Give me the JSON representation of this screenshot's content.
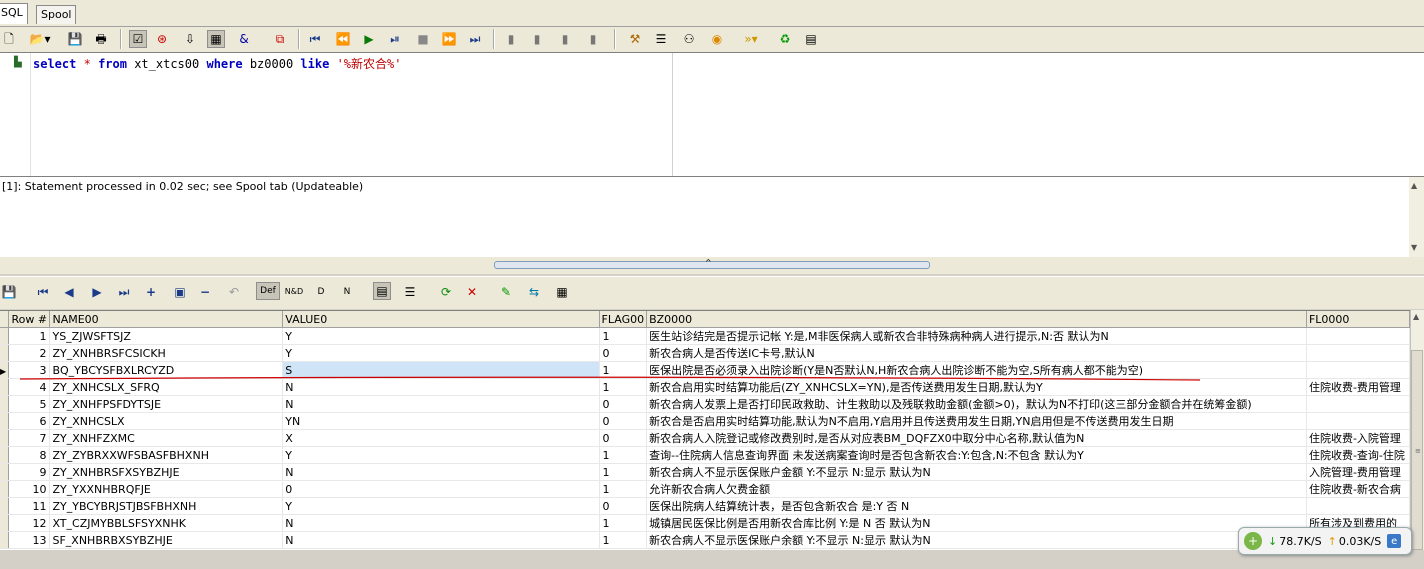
{
  "tabs": [
    {
      "label": "SQL",
      "active": true
    },
    {
      "label": "Spool",
      "active": false
    }
  ],
  "toolbar": {
    "icons": [
      "new-icon",
      "open-icon",
      "save-icon",
      "print-icon",
      "options-icon",
      "explain-icon",
      "commit-icon",
      "query-builder-icon",
      "find-icon",
      "window-icon",
      "first-icon",
      "prev-icon",
      "run-icon",
      "run-step-icon",
      "stop-icon",
      "next-icon",
      "last-icon",
      "doc1-icon",
      "doc2-icon",
      "doc3-icon",
      "doc4-icon",
      "tools-icon",
      "list-icon",
      "binoculars-icon",
      "spinner-icon",
      "bookmark-icon",
      "recycle-icon",
      "grid-icon"
    ]
  },
  "editor": {
    "kw_select": "select",
    "star": "*",
    "kw_from": "from",
    "table": "xt_xtcs00",
    "kw_where": "where",
    "column": "bz0000",
    "kw_like": "like",
    "pattern": "'%新农合%'"
  },
  "message": "[1]: Statement processed in 0.02 sec; see Spool tab (Updateable)",
  "grid": {
    "columns": [
      "Row #",
      "NAME00",
      "VALUE0",
      "FLAG00",
      "BZ0000",
      "FL0000"
    ],
    "rows": [
      {
        "n": "1",
        "name": "YS_ZJWSFTSJZ",
        "value": "Y",
        "flag": "1",
        "bz": "医生站诊结完是否提示记帐 Y:是,M非医保病人或新农合非特殊病种病人进行提示,N:否 默认为N",
        "fl": ""
      },
      {
        "n": "2",
        "name": "ZY_XNHBRSFCSICKH",
        "value": "Y",
        "flag": "0",
        "bz": "新农合病人是否传送IC卡号,默认N",
        "fl": ""
      },
      {
        "n": "3",
        "name": "BQ_YBCYSFBXLRCYZD",
        "value": "S",
        "flag": "1",
        "bz": "医保出院是否必须录入出院诊断(Y是N否默认N,H新农合病人出院诊断不能为空,S所有病人都不能为空)",
        "fl": ""
      },
      {
        "n": "4",
        "name": "ZY_XNHCSLX_SFRQ",
        "value": "N",
        "flag": "1",
        "bz": "新农合启用实时结算功能后(ZY_XNHCSLX=YN),是否传送费用发生日期,默认为Y",
        "fl": "住院收费-费用管理"
      },
      {
        "n": "5",
        "name": "ZY_XNHFPSFDYTSJE",
        "value": "N",
        "flag": "0",
        "bz": "新农合病人发票上是否打印民政救助、计生救助以及残联救助金额(金额>0)，默认为N不打印(这三部分金额合并在统筹金额)",
        "fl": ""
      },
      {
        "n": "6",
        "name": "ZY_XNHCSLX",
        "value": "YN",
        "flag": "0",
        "bz": "新农合是否启用实时结算功能,默认为N不启用,Y启用并且传送费用发生日期,YN启用但是不传送费用发生日期",
        "fl": ""
      },
      {
        "n": "7",
        "name": "ZY_XNHFZXMC",
        "value": "X",
        "flag": "0",
        "bz": "新农合病人入院登记或修改费别时,是否从对应表BM_DQFZX0中取分中心名称,默认值为N",
        "fl": "住院收费-入院管理"
      },
      {
        "n": "8",
        "name": "ZY_ZYBRXXWFSBASFBHXNH",
        "value": "Y",
        "flag": "1",
        "bz": "查询--住院病人信息查询界面 未发送病案查询时是否包含新农合:Y:包含,N:不包含 默认为Y",
        "fl": "住院收费-查询-住院"
      },
      {
        "n": "9",
        "name": "ZY_XNHBRSFXSYBZHJE",
        "value": "N",
        "flag": "1",
        "bz": "新农合病人不显示医保账户金额 Y:不显示 N:显示 默认为N",
        "fl": "入院管理-费用管理"
      },
      {
        "n": "10",
        "name": "ZY_YXXNHBRQFJE",
        "value": "0",
        "flag": "1",
        "bz": "允许新农合病人欠费金额",
        "fl": "住院收费-新农合病"
      },
      {
        "n": "11",
        "name": "ZY_YBCYBRJSTJBSFBHXNH",
        "value": "Y",
        "flag": "0",
        "bz": "医保出院病人结算统计表，是否包含新农合 是:Y 否 N",
        "fl": ""
      },
      {
        "n": "12",
        "name": "XT_CZJMYBBLSFSYXNHK",
        "value": "N",
        "flag": "1",
        "bz": "城镇居民医保比例是否用新农合库比例 Y:是 N 否 默认为N",
        "fl": "所有涉及到费用的"
      },
      {
        "n": "13",
        "name": "SF_XNHBRBXSYBZHJE",
        "value": "N",
        "flag": "1",
        "bz": "新农合病人不显示医保账户余额 Y:不显示 N:显示 默认为N",
        "fl": ""
      }
    ]
  },
  "net": {
    "down": "78.7K/S",
    "up": "0.03K/S"
  },
  "colors": {
    "accent": "#0000c0",
    "annotation": "#cc0000",
    "selection": "#cfe4f7"
  }
}
